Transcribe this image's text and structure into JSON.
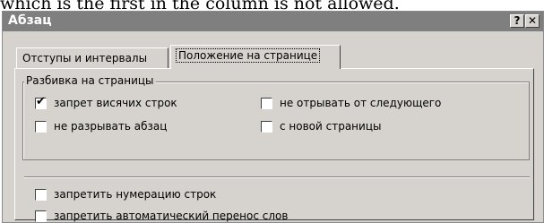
{
  "caption": "which is the first in the column is not allowed.",
  "window": {
    "title": "Абзац",
    "help_label": "?",
    "close_label": "✕"
  },
  "tabs": [
    {
      "label": "Отступы и интервалы",
      "active": false
    },
    {
      "label": "Положение на странице",
      "active": true
    }
  ],
  "pagination": {
    "label": "Разбивка на страницы",
    "options": [
      {
        "label": "запрет висячих строк",
        "checked": true
      },
      {
        "label": "не отрывать от следующего",
        "checked": false
      },
      {
        "label": "не разрывать абзац",
        "checked": false
      },
      {
        "label": "с новой страницы",
        "checked": false
      }
    ]
  },
  "extra_options": [
    {
      "label": "запретить нумерацию строк",
      "checked": false
    },
    {
      "label": "запретить автоматический перенос слов",
      "checked": false
    }
  ]
}
